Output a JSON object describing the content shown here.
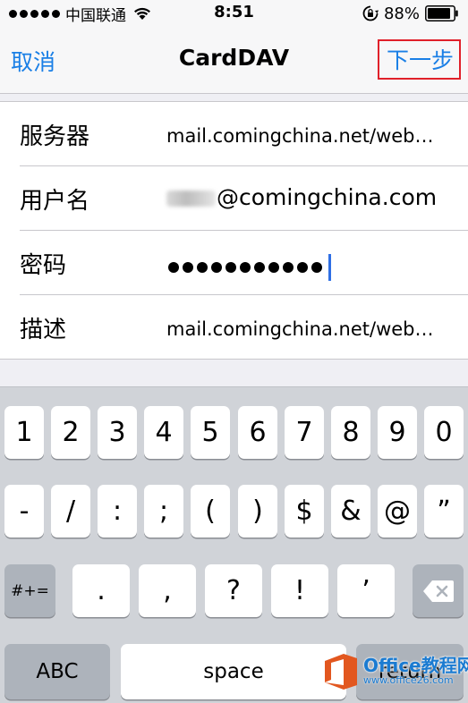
{
  "status_bar": {
    "carrier": "中国联通",
    "time": "8:51",
    "battery": "88%",
    "signal_icon": "signal-dots-icon",
    "wifi_icon": "wifi-icon",
    "lock_icon": "rotation-lock-icon",
    "battery_icon": "battery-icon"
  },
  "nav": {
    "cancel": "取消",
    "title": "CardDAV",
    "next": "下一步",
    "accent_color": "#1a7fe6",
    "highlight_color": "#e0202a"
  },
  "form": {
    "rows": [
      {
        "label": "服务器",
        "value": "mail.comingchina.net/web…"
      },
      {
        "label": "用户名",
        "value": "@comingchina.com"
      },
      {
        "label": "密码",
        "value": "●●●●●●●●●●●"
      },
      {
        "label": "描述",
        "value": "mail.comingchina.net/web…"
      }
    ]
  },
  "keyboard": {
    "row1": [
      "1",
      "2",
      "3",
      "4",
      "5",
      "6",
      "7",
      "8",
      "9",
      "0"
    ],
    "row2": [
      "-",
      "/",
      ":",
      ";",
      "(",
      ")",
      "$",
      "&",
      "@",
      "”"
    ],
    "row3": {
      "shift": "#+=",
      "keys": [
        ".",
        ",",
        "?",
        "!",
        "’"
      ],
      "backspace_icon": "backspace-icon"
    },
    "row4": {
      "abc": "ABC",
      "space": "space",
      "return": "return"
    }
  },
  "watermark": {
    "text": "Office教程网",
    "url": "www.office26.com",
    "logo_icon": "office-logo-icon"
  }
}
